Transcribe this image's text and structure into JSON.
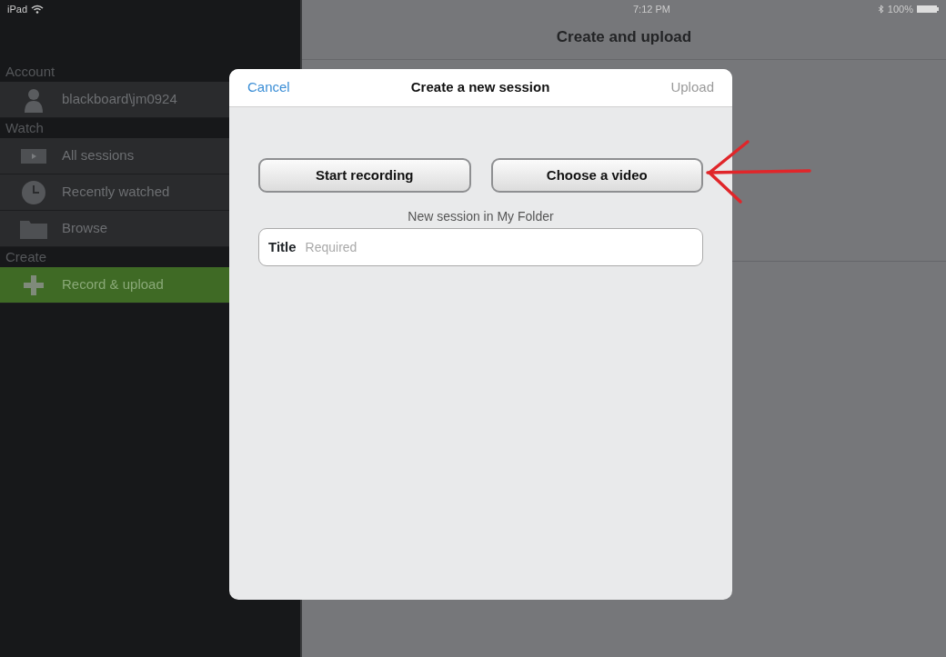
{
  "status_bar": {
    "carrier": "iPad",
    "time": "7:12 PM",
    "battery": "100%"
  },
  "sidebar": {
    "sections": [
      {
        "heading": "Account",
        "items": [
          {
            "kind": "user",
            "label": "blackboard\\jm0924",
            "selected": false
          }
        ]
      },
      {
        "heading": "Watch",
        "items": [
          {
            "kind": "video",
            "label": "All sessions",
            "selected": false
          },
          {
            "kind": "clock",
            "label": "Recently watched",
            "selected": false
          },
          {
            "kind": "folder",
            "label": "Browse",
            "selected": false
          }
        ]
      },
      {
        "heading": "Create",
        "items": [
          {
            "kind": "plus",
            "label": "Record & upload",
            "selected": true
          }
        ]
      }
    ]
  },
  "main": {
    "title": "Create and upload"
  },
  "dialog": {
    "cancel": "Cancel",
    "title": "Create a new session",
    "upload": {
      "label": "Upload",
      "disabled": true
    },
    "buttons": [
      "Start recording",
      "Choose a video"
    ],
    "note": "New session in My Folder",
    "field": {
      "label": "Title",
      "placeholder": "Required"
    }
  }
}
